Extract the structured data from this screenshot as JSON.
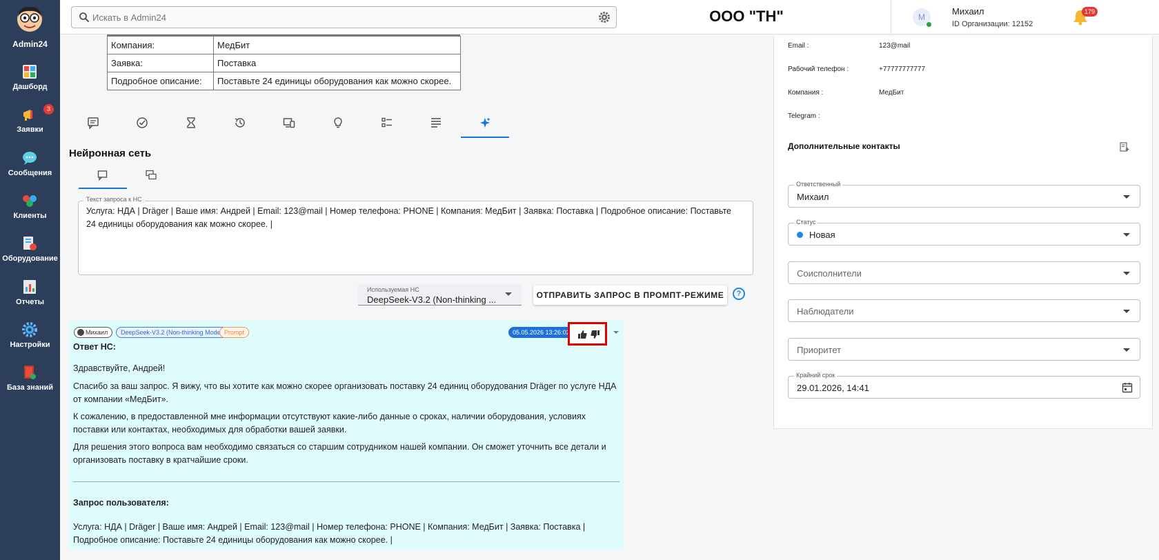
{
  "app": {
    "name": "Admin24",
    "org_title": "ООО \"ТН\"",
    "search_placeholder": "Искать в Admin24"
  },
  "sidebar": {
    "items": [
      {
        "label": "Дашборд",
        "icon": "dashboard-icon"
      },
      {
        "label": "Заявки",
        "icon": "megaphone-icon",
        "badge": "3"
      },
      {
        "label": "Сообщения",
        "icon": "chat-icon"
      },
      {
        "label": "Клиенты",
        "icon": "clients-icon"
      },
      {
        "label": "Оборудование",
        "icon": "equipment-icon"
      },
      {
        "label": "Отчеты",
        "icon": "reports-icon"
      },
      {
        "label": "Настройки",
        "icon": "settings-icon"
      },
      {
        "label": "База знаний",
        "icon": "knowledge-base-icon"
      }
    ]
  },
  "header": {
    "user_initial": "М",
    "user_name": "Михаил",
    "org_id": "ID Организации: 12152",
    "notifications": "179",
    "help": "?"
  },
  "info_table": {
    "rows": [
      {
        "key": "Компания:",
        "value": "МедБит"
      },
      {
        "key": "Заявка:",
        "value": "Поставка"
      },
      {
        "key": "Подробное описание:",
        "value": "Поставьте 24 единицы оборудования как можно скорее."
      }
    ]
  },
  "tabs": [
    "comments-icon",
    "check-circle-icon",
    "hourglass-icon",
    "history-icon",
    "devices-icon",
    "lightbulb-icon",
    "checklist-icon",
    "text-align-icon",
    "sparkle-icon"
  ],
  "neural": {
    "section_title": "Нейронная сеть",
    "prompt_legend": "Текст запроса к НС",
    "prompt_text": "Услуга: НДА | Dräger | Ваше имя: Андрей | Email: 123@mail | Номер телефона: PHONE | Компания: МедБит | Заявка: Поставка | Подробное описание: Поставьте 24 единицы оборудования как можно скорее. |",
    "model_label": "Используемая НС",
    "model_value": "DeepSeek-V3.2 (Non-thinking ...",
    "send_button": "ОТПРАВИТЬ ЗАПРОС В ПРОМПТ-РЕЖИМЕ",
    "help": "?"
  },
  "answer": {
    "chip_user": "Михаил",
    "chip_model": "DeepSeek-V3.2 (Non-thinking Mode)",
    "chip_prompt": "Prompt",
    "date": "05.05.2026 13:26:02",
    "heading": "Ответ НС:",
    "greeting": "Здравствуйте, Андрей!",
    "p1": "Спасибо за ваш запрос. Я вижу, что вы хотите как можно скорее организовать поставку 24 единиц оборудования Dräger по услуге НДА от компании «МедБит».",
    "p2": "К сожалению, в предоставленной мне информации отсутствуют какие-либо данные о сроках, наличии оборудования, условиях поставки или контактах, необходимых для обработки вашей заявки.",
    "p3": "Для решения этого вопроса вам необходимо связаться со старшим сотрудником нашей компании. Он сможет уточнить все детали и организовать поставку в кратчайшие сроки.",
    "request_heading": "Запрос пользователя:",
    "request_text": "Услуга: НДА | Dräger | Ваше имя: Андрей | Email: 123@mail | Номер телефона: PHONE | Компания: МедБит | Заявка: Поставка | Подробное описание: Поставьте 24 единицы оборудования как можно скорее. |"
  },
  "right_panel": {
    "contacts": [
      {
        "label": "Email :",
        "value": "123@mail"
      },
      {
        "label": "Рабочий телефон :",
        "value": "+77777777777"
      },
      {
        "label": "Компания :",
        "value": "МедБит"
      },
      {
        "label": "Telegram :",
        "value": ""
      }
    ],
    "extra_contacts_title": "Дополнительные контакты",
    "responsible_label": "Ответственный",
    "responsible_value": "Михаил",
    "status_label": "Статус",
    "status_value": "Новая",
    "co_executors": "Соисполнители",
    "observers": "Наблюдатели",
    "priority": "Приоритет",
    "deadline_label": "Крайний срок",
    "deadline_value": "29.01.2026, 14:41"
  },
  "colors": {
    "sidebar": "#2c3e5a",
    "accent": "#1976d2",
    "answer_bg": "#dffcfd",
    "highlight": "#e00000"
  }
}
